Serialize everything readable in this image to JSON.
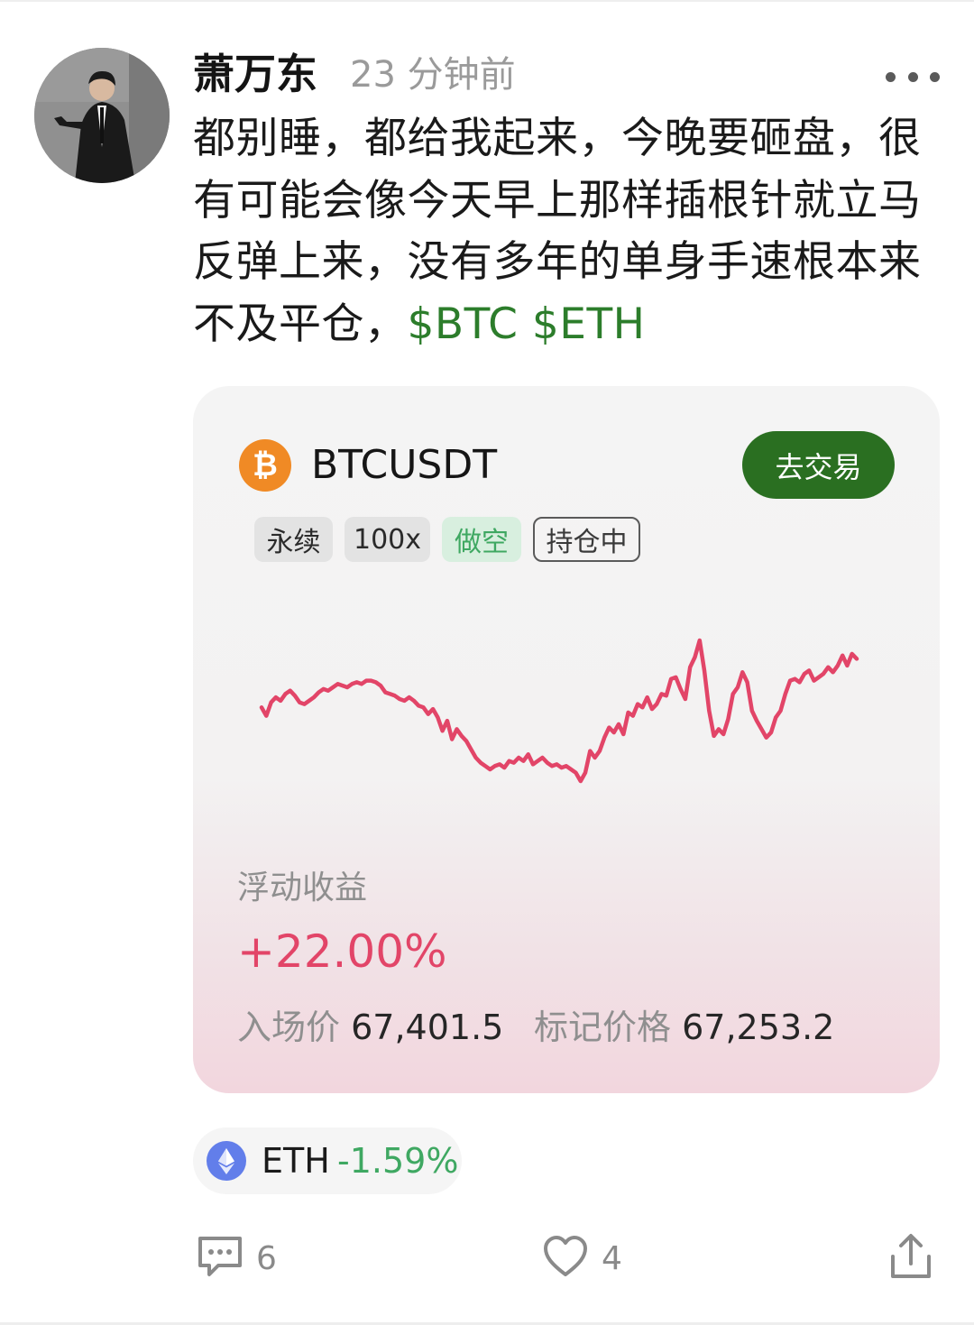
{
  "post": {
    "author": "萧万东",
    "time": "23 分钟前",
    "text": "都别睡，都给我起来，今晚要砸盘，很有可能会像今天早上那样插根针就立马反弹上来，没有多年的单身手速根本来不及平仓，",
    "tags": "$BTC $ETH"
  },
  "card": {
    "symbol": "BTCUSDT",
    "coin_icon": "bitcoin-icon",
    "trade_button": "去交易",
    "chips": [
      "永续",
      "100x",
      "做空",
      "持仓中"
    ],
    "pnl_label": "浮动收益",
    "pnl_value": "+22.00%",
    "entry_label": "入场价",
    "entry_value": "67,401.5",
    "mark_label": "标记价格",
    "mark_value": "67,253.2",
    "colors": {
      "trade_button": "#2a6f21",
      "pnl": "#e24568",
      "line": "#e24568",
      "short_chip_text": "#3fa862"
    }
  },
  "chart_data": {
    "type": "line",
    "title": "",
    "xlabel": "",
    "ylabel": "",
    "grid": false,
    "series": [
      {
        "values": [
          52,
          47,
          55,
          58,
          56,
          60,
          62,
          59,
          55,
          54,
          56,
          58,
          61,
          63,
          62,
          64,
          66,
          65,
          64,
          66,
          67,
          66,
          68,
          68,
          67,
          65,
          61,
          60,
          59,
          57,
          56,
          58,
          56,
          53,
          52,
          48,
          51,
          46,
          38,
          44,
          33,
          39,
          35,
          32,
          27,
          22,
          19,
          17,
          15,
          17,
          18,
          16,
          20,
          19,
          22,
          20,
          24,
          18,
          20,
          22,
          19,
          17,
          18,
          16,
          17,
          15,
          13,
          8,
          13,
          26,
          22,
          26,
          34,
          40,
          37,
          42,
          36,
          49,
          47,
          54,
          52,
          58,
          51,
          54,
          60,
          59,
          69,
          70,
          63,
          57,
          76,
          82,
          92,
          74,
          50,
          35,
          39,
          36,
          45,
          60,
          64,
          73,
          67,
          50,
          44,
          39,
          34,
          37,
          46,
          50,
          60,
          68,
          69,
          67,
          72,
          74,
          68,
          70,
          72,
          76,
          73,
          77,
          83,
          77,
          84,
          81
        ]
      }
    ]
  },
  "eth": {
    "icon": "ethereum-icon",
    "name": "ETH",
    "change": "-1.59%"
  },
  "actions": {
    "comments": "6",
    "likes": "4"
  }
}
